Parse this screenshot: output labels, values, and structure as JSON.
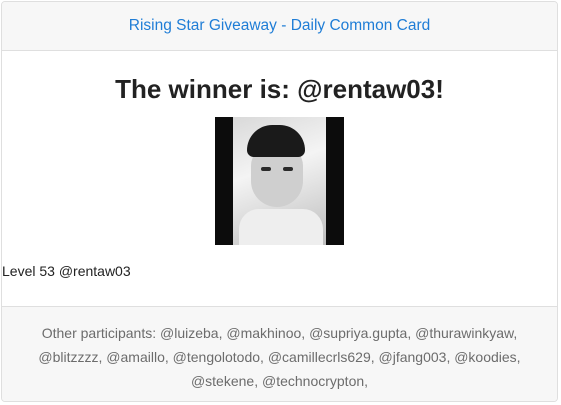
{
  "header": {
    "title": "Rising Star Giveaway - Daily Common Card"
  },
  "winner": {
    "title": "The winner is: @rentaw03!",
    "level_label": "Level 53 @rentaw03",
    "photo_alt": "rentaw03"
  },
  "footer": {
    "participants_label": "Other participants:",
    "participants": "@luizeba, @makhinoo, @supriya.gupta, @thurawinkyaw, @blitzzzz, @amaillo, @tengolotodo, @camillecrls629, @jfang003, @koodies, @stekene, @technocrypton,"
  }
}
